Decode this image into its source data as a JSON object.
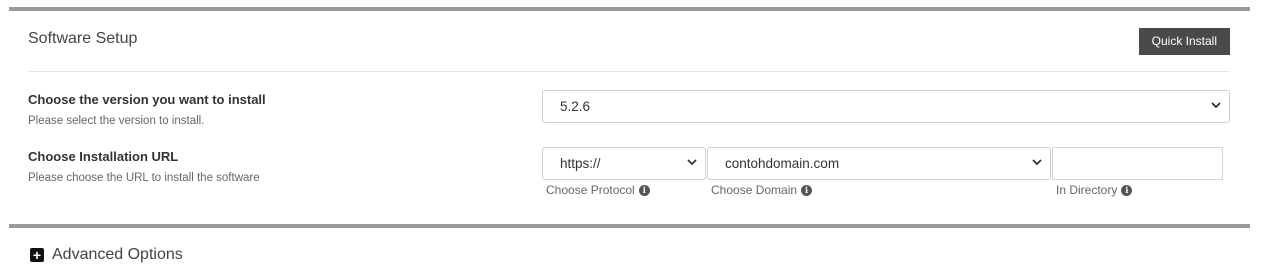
{
  "panel": {
    "title": "Software Setup",
    "quick_install_label": "Quick Install"
  },
  "version": {
    "label": "Choose the version you want to install",
    "help": "Please select the version to install.",
    "selected": "5.2.6"
  },
  "install_url": {
    "label": "Choose Installation URL",
    "help": "Please choose the URL to install the software",
    "protocol": {
      "selected": "https://",
      "caption": "Choose Protocol"
    },
    "domain": {
      "selected": "contohdomain.com",
      "caption": "Choose Domain"
    },
    "directory": {
      "value": "",
      "caption": "In Directory"
    }
  },
  "advanced": {
    "label": "Advanced Options"
  },
  "icons": {
    "info": "info-icon",
    "chevron": "chevron-down-icon",
    "expand": "plus-square-icon"
  }
}
